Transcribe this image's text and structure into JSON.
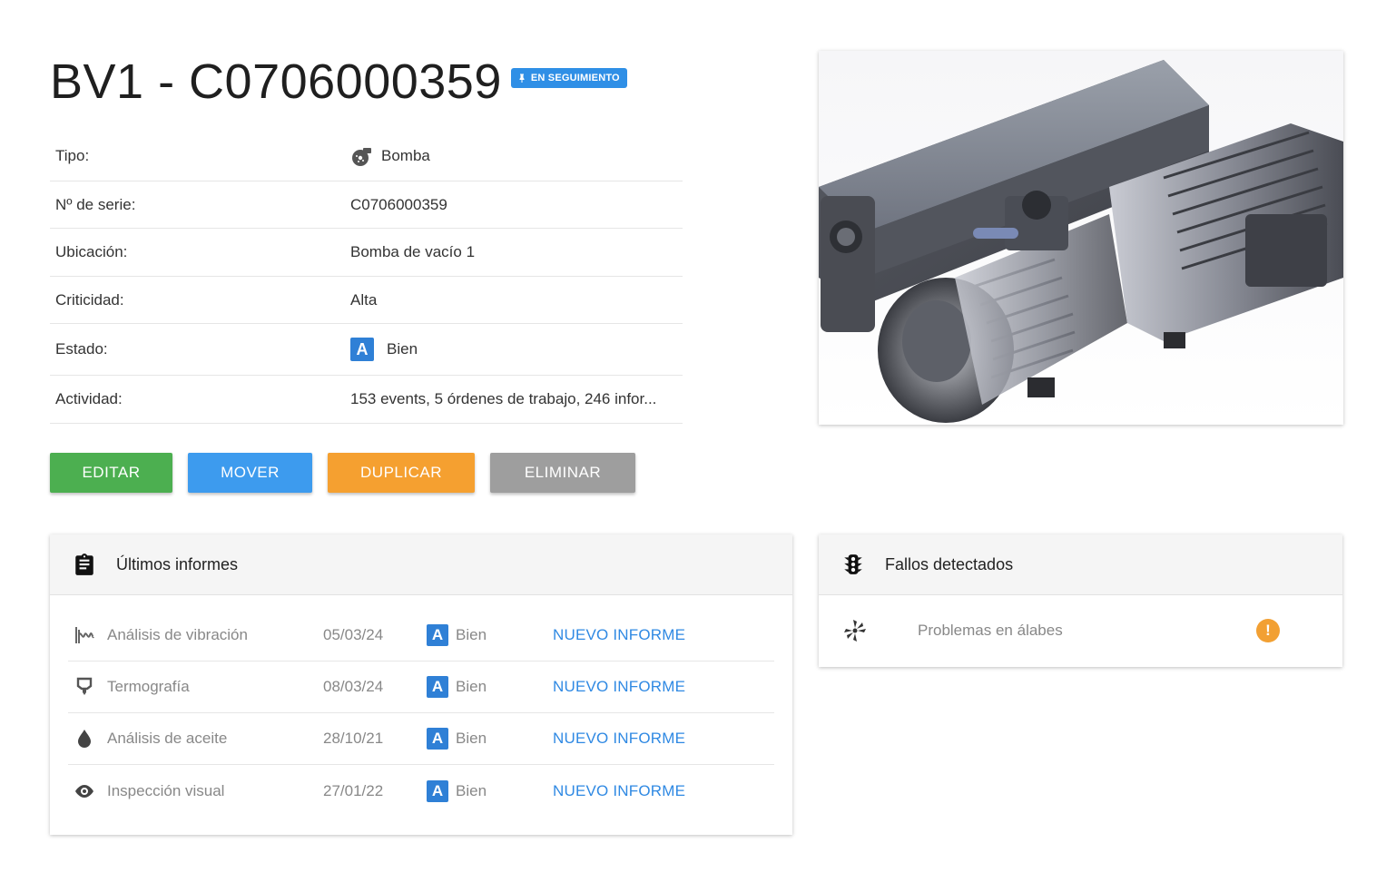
{
  "header": {
    "title": "BV1 - C0706000359",
    "badge": "EN SEGUIMIENTO"
  },
  "info": {
    "rows": [
      {
        "label": "Tipo:",
        "value": "Bomba",
        "icon": "pump-icon"
      },
      {
        "label": "Nº de serie:",
        "value": "C0706000359"
      },
      {
        "label": "Ubicación:",
        "value": "Bomba de vacío 1"
      },
      {
        "label": "Criticidad:",
        "value": "Alta"
      },
      {
        "label": "Estado:",
        "value": "Bien",
        "grade": "A"
      },
      {
        "label": "Actividad:",
        "value": "153 events, 5 órdenes de trabajo, 246 infor..."
      }
    ]
  },
  "actions": {
    "edit": "EDITAR",
    "move": "MOVER",
    "duplicate": "DUPLICAR",
    "delete": "ELIMINAR"
  },
  "reports": {
    "title": "Últimos informes",
    "items": [
      {
        "name": "Análisis de vibración",
        "date": "05/03/24",
        "grade": "A",
        "status": "Bien",
        "action": "NUEVO INFORME",
        "icon": "vibration-icon"
      },
      {
        "name": "Termografía",
        "date": "08/03/24",
        "grade": "A",
        "status": "Bien",
        "action": "NUEVO INFORME",
        "icon": "thermography-icon"
      },
      {
        "name": "Análisis de aceite",
        "date": "28/10/21",
        "grade": "A",
        "status": "Bien",
        "action": "NUEVO INFORME",
        "icon": "oil-drop-icon"
      },
      {
        "name": "Inspección visual",
        "date": "27/01/22",
        "grade": "A",
        "status": "Bien",
        "action": "NUEVO INFORME",
        "icon": "eye-icon"
      }
    ]
  },
  "faults": {
    "title": "Fallos detectados",
    "items": [
      {
        "name": "Problemas en álabes",
        "icon": "impeller-icon",
        "alert": "!"
      }
    ]
  },
  "colors": {
    "grade_a": "#2f80d6",
    "badge": "#2f8fe6",
    "edit": "#4caf50",
    "move": "#3d9bee",
    "duplicate": "#f5a030",
    "delete": "#9e9e9e",
    "link": "#2f89e3",
    "warning": "#f2a033"
  }
}
